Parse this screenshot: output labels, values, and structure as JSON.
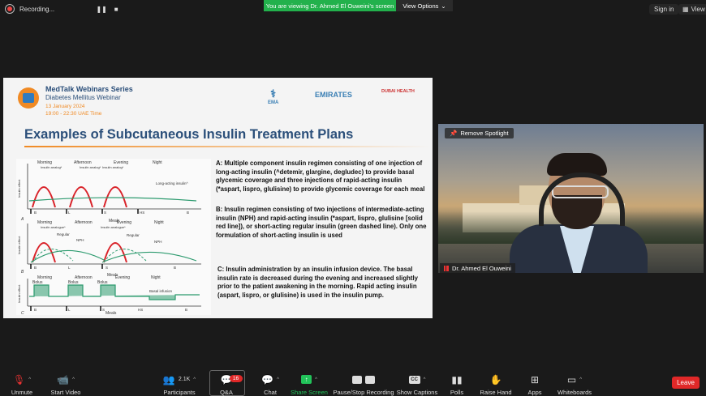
{
  "top_bar": {
    "recording_label": "Recording...",
    "pause_icon": "pause-icon",
    "stop_icon": "stop-icon",
    "banner_text": "You are viewing Dr. Ahmed El Ouweini's screen",
    "view_options_label": "View Options",
    "sign_in_label": "Sign in",
    "view_label": "View",
    "colors": {
      "banner": "#22b14c",
      "recording_dot": "#e44444"
    }
  },
  "slide": {
    "series_title": "MedTalk Webinars Series",
    "series_subtitle": "Diabetes Mellitus Webinar",
    "date_line": "13 January 2024",
    "time_line": "19:00 - 22:30 UAE Time",
    "partners": [
      "EMA",
      "EMIRATES",
      "DUBAI HEALTH"
    ],
    "heading": "Examples of Subcutaneous Insulin Treatment Plans",
    "paragraph_a": "A: Multiple component insulin regimen consisting of one injection of long-acting insulin (^detemir, glargine, degludec) to provide basal glycemic coverage and three injections of rapid-acting insulin (*aspart, lispro, glulisine) to provide glycemic coverage for each meal",
    "paragraph_b": "B: Insulin regimen consisting of two injections of intermediate-acting insulin (NPH) and rapid-acting insulin (*aspart, lispro, glulisine [solid red line]), or short-acting regular insulin (green dashed line). Only one formulation of short-acting insulin is used",
    "paragraph_c": "C: Insulin administration by an insulin infusion device. The basal insulin rate is decreased during the evening and increased slightly prior to the patient awakening in the morning. Rapid acting insulin (aspart, lispro, or glulisine) is used in the insulin pump.",
    "colors": {
      "heading": "#2b4f7a",
      "accent": "#f08a24",
      "rapid": "#d9232a",
      "basal": "#2c9a6e",
      "pump": "#2c9a6e"
    }
  },
  "diagram": {
    "y_axis_label": "Insulin effect",
    "x_axis_label": "Meals",
    "panel_a": {
      "times": [
        "Morning",
        "Afternoon",
        "Evening",
        "Night"
      ],
      "rapid_labels": [
        "Insulin analog*",
        "Insulin analog*",
        "Insulin analog*"
      ],
      "basal_label": "Long-acting insulin^",
      "meals": [
        "B",
        "L",
        "S",
        "HS",
        "B"
      ],
      "letter": "A"
    },
    "panel_b": {
      "times": [
        "Morning",
        "Afternoon",
        "Evening",
        "Night"
      ],
      "rapid_labels": [
        "Insulin analogue*",
        "Insulin analogue*"
      ],
      "regular_labels": [
        "Regular",
        "Regular"
      ],
      "nph_labels": [
        "NPH",
        "NPH"
      ],
      "meals": [
        "B",
        "L",
        "S",
        "B"
      ],
      "letter": "B"
    },
    "panel_c": {
      "times": [
        "Morning",
        "Afternoon",
        "Evening",
        "Night"
      ],
      "bolus_labels": [
        "Bolus",
        "Bolus",
        "Bolus"
      ],
      "basal_label": "Basal infusion",
      "meals": [
        "B",
        "L",
        "S",
        "HS",
        "B"
      ],
      "letter": "C"
    }
  },
  "video": {
    "remove_spotlight_label": "Remove Spotlight",
    "participant_name": "Dr. Ahmed El Ouweini",
    "mic_icon": "mic-level-icon"
  },
  "toolbar": {
    "unmute": "Unmute",
    "start_video": "Start Video",
    "participants": "Participants",
    "participants_count": "2.1K",
    "qa": "Q&A",
    "qa_badge": "16",
    "chat": "Chat",
    "share_screen": "Share Screen",
    "pause_stop_recording": "Pause/Stop Recording",
    "show_captions": "Show Captions",
    "polls": "Polls",
    "raise_hand": "Raise Hand",
    "apps": "Apps",
    "whiteboards": "Whiteboards",
    "leave": "Leave",
    "colors": {
      "share": "#22c35a",
      "leave": "#e02828"
    }
  }
}
